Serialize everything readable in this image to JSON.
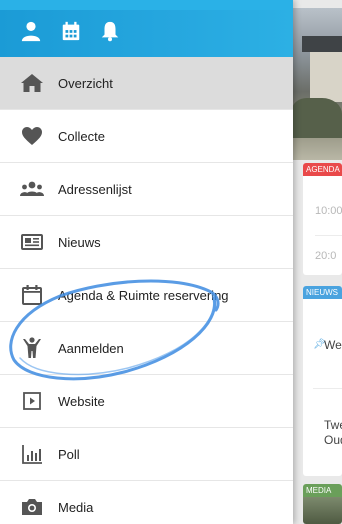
{
  "header": {
    "icons": [
      "user-icon",
      "calendar-icon",
      "bell-icon"
    ],
    "color": "#1b9bd6"
  },
  "menu": {
    "items": [
      {
        "label": "Overzicht",
        "icon": "home-icon",
        "active": true
      },
      {
        "label": "Collecte",
        "icon": "heart-icon"
      },
      {
        "label": "Adressenlijst",
        "icon": "people-icon"
      },
      {
        "label": "Nieuws",
        "icon": "newspaper-icon"
      },
      {
        "label": "Agenda & Ruimte reservering",
        "icon": "calendar-outline-icon"
      },
      {
        "label": "Aanmelden",
        "icon": "person-raise-icon"
      },
      {
        "label": "Website",
        "icon": "play-box-icon"
      },
      {
        "label": "Poll",
        "icon": "bar-chart-icon"
      },
      {
        "label": "Media",
        "icon": "camera-icon"
      }
    ]
  },
  "background": {
    "card_agenda_tag": "AGENDA",
    "card_agenda_time1": "10:00",
    "card_agenda_time2": "20:0",
    "card_news_tag": "NIEUWS",
    "card_news_line1": "We",
    "card_news_line2a": "Twe",
    "card_news_line2b": "Oud",
    "card_media_tag": "MEDIA"
  },
  "colors": {
    "accent": "#1b9bd6",
    "agenda": "#e9494a",
    "news": "#4aa3df",
    "media": "#6a9f5a",
    "annotation": "#3d8be0"
  }
}
